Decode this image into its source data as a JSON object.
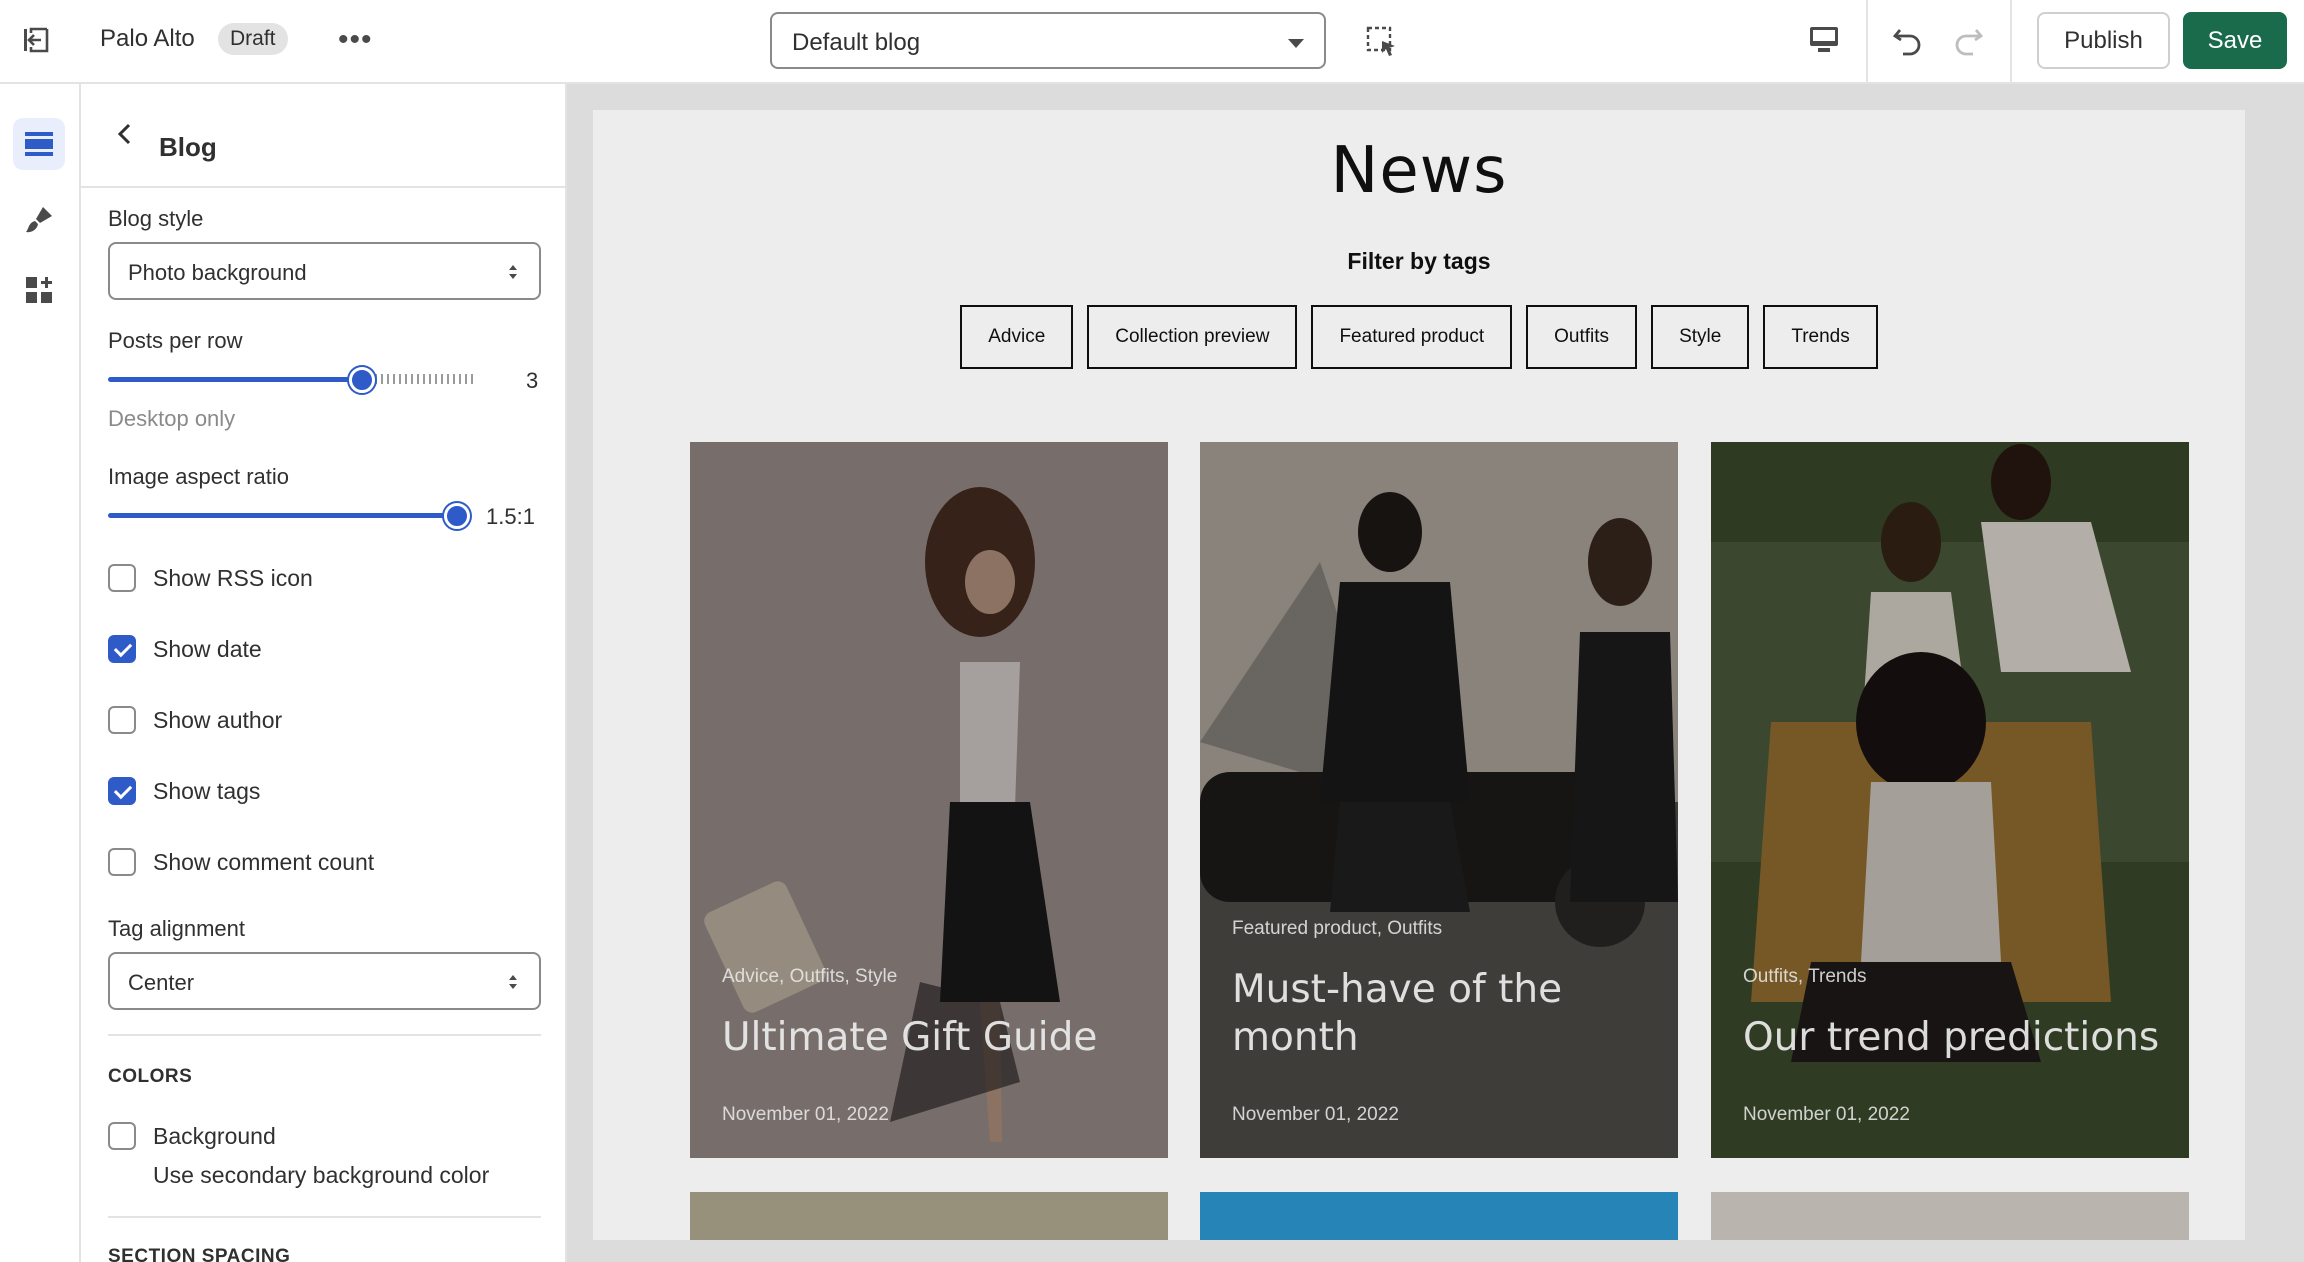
{
  "topbar": {
    "store_name": "Palo Alto",
    "status_badge": "Draft",
    "template_select": "Default blog",
    "publish_label": "Publish",
    "save_label": "Save"
  },
  "panel": {
    "title": "Blog",
    "blog_style": {
      "label": "Blog style",
      "value": "Photo background"
    },
    "posts_per_row": {
      "label": "Posts per row",
      "value": "3",
      "help": "Desktop only",
      "level": 0.64
    },
    "image_aspect_ratio": {
      "label": "Image aspect ratio",
      "value": "1.5:1",
      "level": 1.0
    },
    "checkboxes": [
      {
        "label": "Show RSS icon",
        "checked": false
      },
      {
        "label": "Show date",
        "checked": true
      },
      {
        "label": "Show author",
        "checked": false
      },
      {
        "label": "Show tags",
        "checked": true
      },
      {
        "label": "Show comment count",
        "checked": false
      }
    ],
    "tag_alignment": {
      "label": "Tag alignment",
      "value": "Center"
    },
    "colors_heading": "COLORS",
    "background": {
      "label": "Background",
      "help": "Use secondary background color",
      "checked": false
    },
    "section_spacing_heading": "SECTION SPACING"
  },
  "preview": {
    "heading": "News",
    "filter_label": "Filter by tags",
    "tags": [
      "Advice",
      "Collection preview",
      "Featured product",
      "Outfits",
      "Style",
      "Trends"
    ],
    "posts": [
      {
        "tags": "Advice, Outfits, Style",
        "title": "Ultimate Gift Guide",
        "date": "November 01, 2022"
      },
      {
        "tags": "Featured product, Outfits",
        "title": "Must-have of the month",
        "date": "November 01, 2022"
      },
      {
        "tags": "Outfits, Trends",
        "title": "Our trend predictions",
        "date": "November 01, 2022"
      }
    ]
  },
  "colors": {
    "accent": "#2f5bc9",
    "save_button": "#1a6b4c"
  }
}
